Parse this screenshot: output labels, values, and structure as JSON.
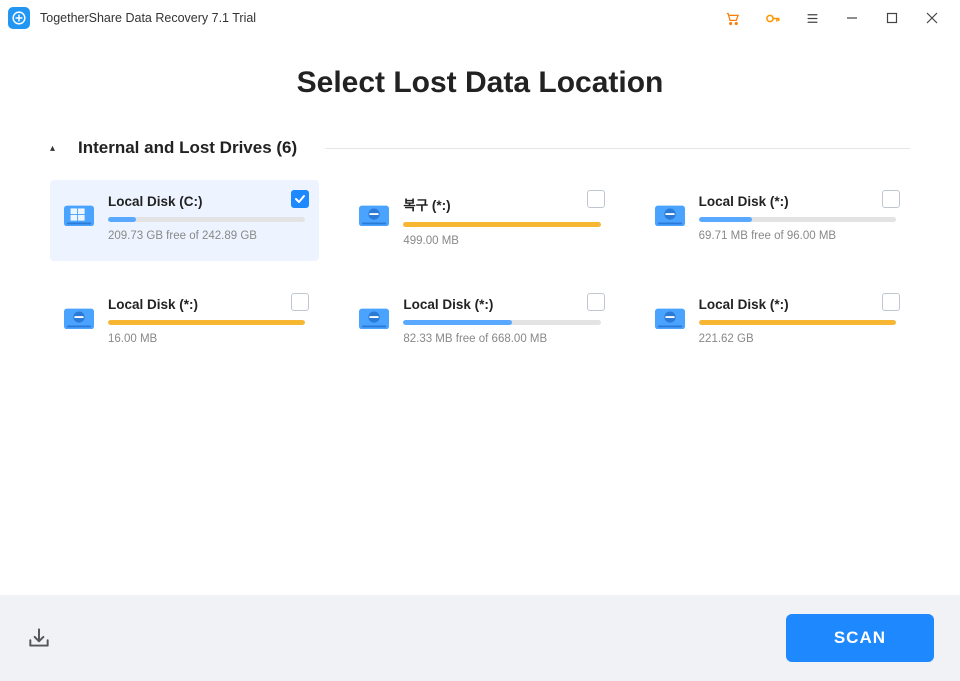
{
  "app": {
    "title": "TogetherShare Data Recovery 7.1 Trial"
  },
  "page": {
    "title": "Select Lost Data Location"
  },
  "section": {
    "title": "Internal and Lost Drives (6)"
  },
  "drives": [
    {
      "name": "Local Disk (C:)",
      "size": "209.73 GB free of 242.89 GB",
      "fill_pct": 14,
      "fill_color": "#58a9ff",
      "icon": "windows",
      "checked": true
    },
    {
      "name": "복구 (*:)",
      "size": "499.00 MB",
      "fill_pct": 100,
      "fill_color": "#f7b733",
      "icon": "disk",
      "checked": false
    },
    {
      "name": "Local Disk (*:)",
      "size": "69.71 MB free of 96.00 MB",
      "fill_pct": 27,
      "fill_color": "#58a9ff",
      "icon": "disk",
      "checked": false
    },
    {
      "name": "Local Disk (*:)",
      "size": "16.00 MB",
      "fill_pct": 100,
      "fill_color": "#f7b733",
      "icon": "disk",
      "checked": false
    },
    {
      "name": "Local Disk (*:)",
      "size": "82.33 MB free of 668.00 MB",
      "fill_pct": 55,
      "fill_color": "#58a9ff",
      "icon": "disk",
      "checked": false
    },
    {
      "name": "Local Disk (*:)",
      "size": "221.62 GB",
      "fill_pct": 100,
      "fill_color": "#f7b733",
      "icon": "disk",
      "checked": false
    }
  ],
  "footer": {
    "scan_label": "SCAN"
  }
}
